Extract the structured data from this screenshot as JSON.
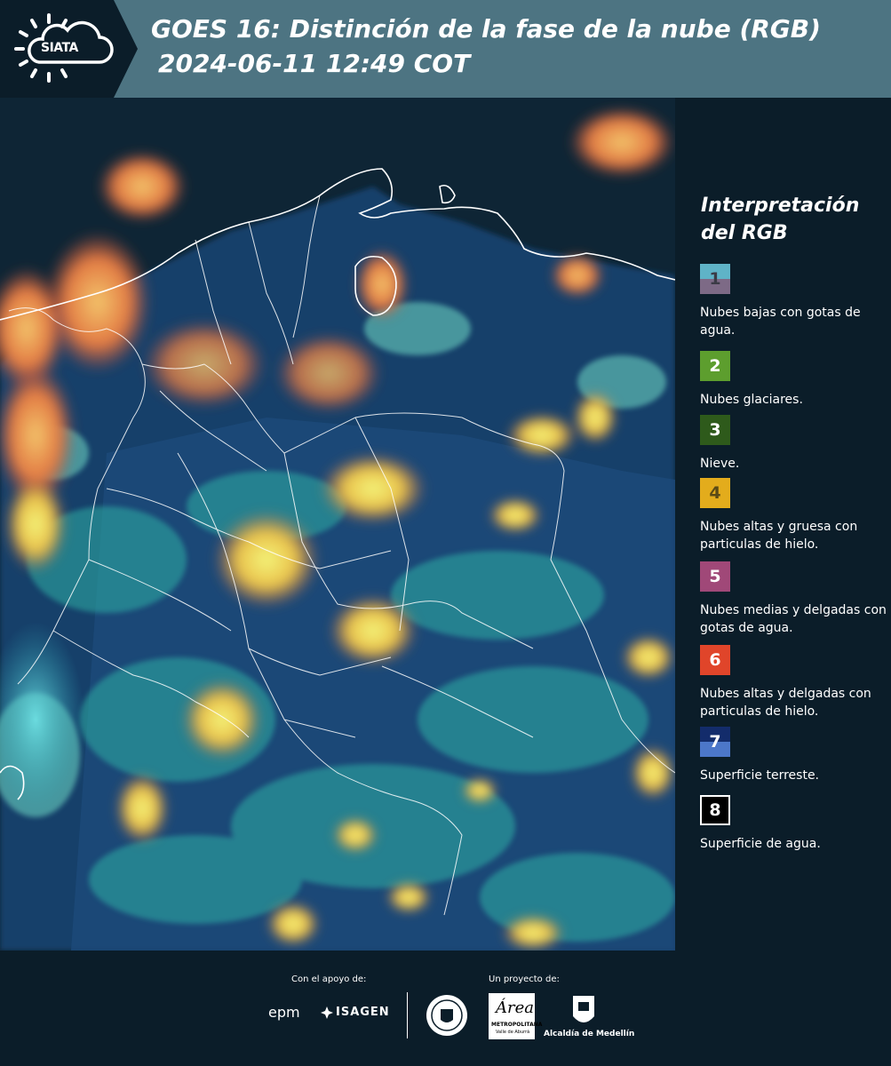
{
  "header": {
    "logo_text": "SIATA",
    "title_line1": "GOES 16: Distinción de la fase de la nube (RGB)",
    "title_line2": "2024-06-11 12:49 COT"
  },
  "map": {
    "icon": "satellite-rgb-map"
  },
  "legend": {
    "title_line1": "Interpretación",
    "title_line2": "del RGB",
    "items": [
      {
        "number": "1",
        "label": "Nubes bajas con gotas de agua.",
        "color": "#5fb3c7",
        "color2": "#7d6a86"
      },
      {
        "number": "2",
        "label": "Nubes glaciares.",
        "color": "#5d9e2e"
      },
      {
        "number": "3",
        "label": "Nieve.",
        "color": "#2e5a1b"
      },
      {
        "number": "4",
        "label": "Nubes altas y gruesa con particulas de hielo.",
        "color": "#e3ac1c"
      },
      {
        "number": "5",
        "label": "Nubes medias y delgadas con gotas de agua.",
        "color": "#a04878"
      },
      {
        "number": "6",
        "label": "Nubes altas y delgadas con particulas de hielo.",
        "color": "#e0452a"
      },
      {
        "number": "7",
        "label": "Superficie terreste.",
        "color": "#132c6b",
        "color2": "#4c77c9"
      },
      {
        "number": "8",
        "label": "Superficie de agua.",
        "color": "#000000"
      }
    ]
  },
  "footer": {
    "support_label": "Con el apoyo de:",
    "project_label": "Un proyecto de:",
    "epm": "epm",
    "isagen": "ISAGEN",
    "area_line1": "Área",
    "area_line2": "METROPOLITANA",
    "area_line3": "Valle de Aburrá",
    "medellin": "Alcaldía de Medellín"
  }
}
